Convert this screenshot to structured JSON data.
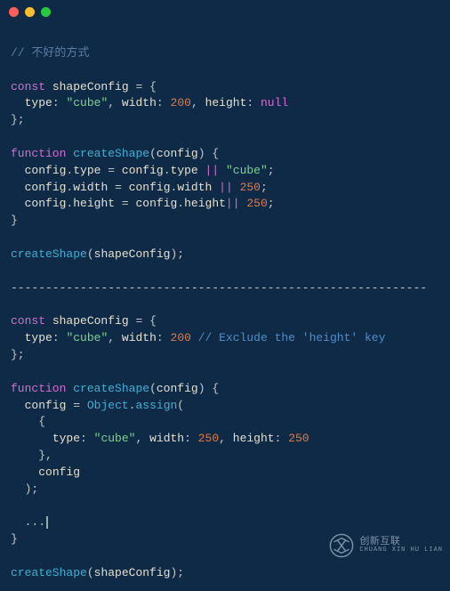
{
  "comment_bad": "// 不好的方式",
  "kw_const": "const",
  "kw_function": "function",
  "kw_null": "null",
  "op_or": "||",
  "var_shapeConfig": "shapeConfig",
  "prop_type": "type",
  "prop_width": "width",
  "prop_height": "height",
  "str_cube": "\"cube\"",
  "num_200": "200",
  "num_250": "250",
  "fn_createShape": "createShape",
  "param_config": "config",
  "sep_line": "------------------------------------------------------------",
  "comment_exclude": "// Exclude the 'height' key",
  "obj_Object": "Object",
  "fn_assign": "assign",
  "ellipsis": "...",
  "watermark_cn": "创新互联",
  "watermark_py": "CHUANG XIN HU LIAN",
  "chart_data": null
}
